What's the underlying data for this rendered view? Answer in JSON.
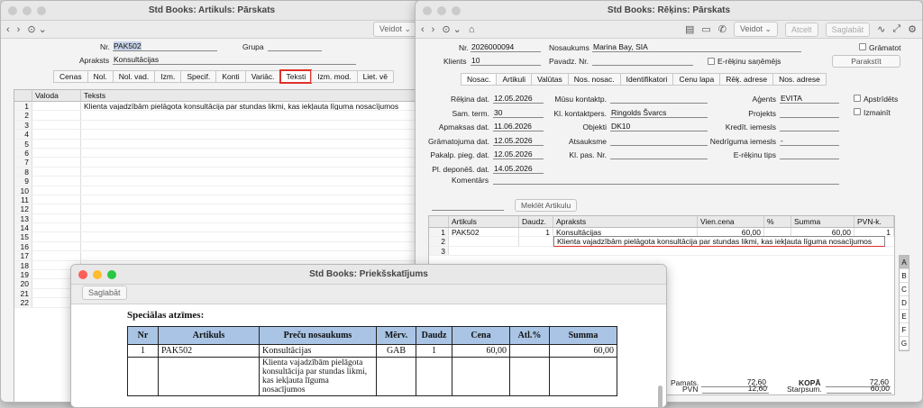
{
  "win_artikuls": {
    "title": "Std Books: Artikuls: Pārskats",
    "veidot": "Veidot ⌄",
    "nr_label": "Nr.",
    "nr_value": "PAK502",
    "grupa_label": "Grupa",
    "apraksts_label": "Apraksts",
    "apraksts_value": "Konsultācijas",
    "tabs": [
      "Cenas",
      "Nol.",
      "Nol. vad.",
      "Izm.",
      "Specif.",
      "Konti",
      "Variāc.",
      "Teksti",
      "Izm. mod.",
      "Liet. vē"
    ],
    "grid_headers": [
      "Valoda",
      "Teksts"
    ],
    "grid_rows": [
      {
        "n": "1",
        "text": "Klienta vajadzībām pielāgota konsultācija par stundas likmi, kas iekļauta līguma nosacījumos"
      },
      {
        "n": "2",
        "text": ""
      },
      {
        "n": "3",
        "text": ""
      },
      {
        "n": "4",
        "text": ""
      },
      {
        "n": "5",
        "text": ""
      },
      {
        "n": "6",
        "text": ""
      },
      {
        "n": "7",
        "text": ""
      },
      {
        "n": "8",
        "text": ""
      },
      {
        "n": "9",
        "text": ""
      },
      {
        "n": "10",
        "text": ""
      },
      {
        "n": "11",
        "text": ""
      },
      {
        "n": "12",
        "text": ""
      },
      {
        "n": "13",
        "text": ""
      },
      {
        "n": "14",
        "text": ""
      },
      {
        "n": "15",
        "text": ""
      },
      {
        "n": "16",
        "text": ""
      },
      {
        "n": "17",
        "text": ""
      },
      {
        "n": "18",
        "text": ""
      },
      {
        "n": "19",
        "text": ""
      },
      {
        "n": "20",
        "text": ""
      },
      {
        "n": "21",
        "text": ""
      },
      {
        "n": "22",
        "text": ""
      }
    ]
  },
  "win_rekins": {
    "title": "Std Books: Rēķins: Pārskats",
    "veidot": "Veidot ⌄",
    "atcelt": "Atcelt",
    "saglabat": "Saglabāt",
    "nr_label": "Nr.",
    "nr_value": "2026000094",
    "nosaukums_label": "Nosaukums",
    "nosaukums_value": "Marina Bay, SIA",
    "gramatot": "Grāmatot",
    "klients_label": "Klients",
    "klients_value": "10",
    "pavadz_label": "Pavadz. Nr.",
    "erekinu": "E-rēķinu saņēmējs",
    "parakstit": "Parakstīt",
    "tabs": [
      "Nosac.",
      "Artikuli",
      "Valūtas",
      "Nos. nosac.",
      "Identifikatori",
      "Cenu lapa",
      "Rēķ. adrese",
      "Nos. adrese"
    ],
    "left_fields": [
      {
        "label": "Rēķina dat.",
        "value": "12.05.2026"
      },
      {
        "label": "Sam. term.",
        "value": "30"
      },
      {
        "label": "Apmaksas dat.",
        "value": "11.06.2026"
      },
      {
        "label": "Grāmatojuma dat.",
        "value": "12.05.2026"
      },
      {
        "label": "Pakalp. pieg. dat.",
        "value": "12.05.2026"
      },
      {
        "label": "Pl. deponēš. dat.",
        "value": "14.05.2026"
      }
    ],
    "mid_fields": [
      {
        "label": "Mūsu kontaktp.",
        "value": ""
      },
      {
        "label": "Kl. kontaktpers.",
        "value": "Ringolds Švarcs"
      },
      {
        "label": "Objekti",
        "value": "DK10"
      },
      {
        "label": "Atsauksme",
        "value": ""
      },
      {
        "label": "Kl. pas. Nr.",
        "value": ""
      }
    ],
    "right_fields": [
      {
        "label": "Aģents",
        "value": "EVITA"
      },
      {
        "label": "Projekts",
        "value": ""
      },
      {
        "label": "Kredīt. iemesls",
        "value": ""
      },
      {
        "label": "Nedrīguma iemesls",
        "value": "-"
      },
      {
        "label": "E-rēķinu tips",
        "value": ""
      }
    ],
    "apstridets": "Apstrīdēts",
    "izmainit": "Izmainīt",
    "komentars_label": "Komentārs",
    "meklet": "Meklēt Artikulu",
    "grid_headers": [
      "Artikuls",
      "Daudz.",
      "Apraksts",
      "Vien.cena",
      "%",
      "Summa",
      "PVN-k."
    ],
    "row1": {
      "n": "1",
      "artikuls": "PAK502",
      "daudz": "1",
      "apraksts": "Konsultācijas",
      "cena": "60,00",
      "pct": "",
      "summa": "60,00",
      "pvn": "1"
    },
    "row2_text": "Klienta vajadzībām pielāgota konsultācija par stundas likmi, kas iekļauta līguma nosacījumos",
    "row_nums": [
      "2",
      "3"
    ],
    "side_letters": [
      "A",
      "B",
      "C",
      "D",
      "E",
      "F",
      "G"
    ],
    "totals": {
      "pvn_label": "PVN",
      "pvn_value": "12,60",
      "pamats_label": "Pamats.",
      "pamats_value": "72,60",
      "starpsum_label": "Starpsum.",
      "starpsum_value": "60,00",
      "kopa_label": "KOPĀ",
      "kopa_value": "72,60"
    }
  },
  "win_preview": {
    "title": "Std Books: Priekšskatījums",
    "saglabat": "Saglabāt",
    "special_label": "Speciālas atzīmes:",
    "headers": [
      "Nr",
      "Artikuls",
      "Preču nosaukums",
      "Mērv.",
      "Daudz",
      "Cena",
      "Atl.%",
      "Summa"
    ],
    "row": {
      "nr": "1",
      "artikuls": "PAK502",
      "nosaukums": "Konsultācijas",
      "merv": "GAB",
      "daudz": "1",
      "cena": "60,00",
      "atl": "",
      "summa": "60,00"
    },
    "desc": "Klienta vajadzībām pielāgota konsultācija par stundas likmi, kas iekļauta līguma nosacījumos"
  }
}
